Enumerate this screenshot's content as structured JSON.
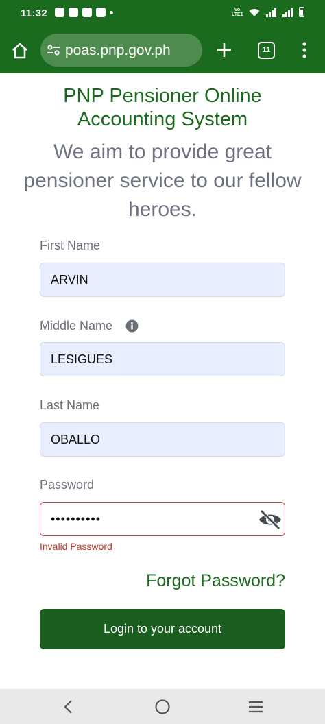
{
  "status_bar": {
    "time": "11:32",
    "volte": "Vo LTE1"
  },
  "browser": {
    "url": "pnpoas.pnp.gov.ph",
    "url_visible": "poas.pnp.gov.ph",
    "tab_count": "11"
  },
  "page": {
    "title": "PNP Pensioner Online Accounting System",
    "subtitle": "We aim to provide great pensioner service to our fellow heroes.",
    "brand_color": "#1b6b1e"
  },
  "form": {
    "first_name": {
      "label": "First Name",
      "value": "ARVIN"
    },
    "middle_name": {
      "label": "Middle Name",
      "value": "LESIGUES"
    },
    "last_name": {
      "label": "Last Name",
      "value": "OBALLO"
    },
    "password": {
      "label": "Password",
      "value": "••••••••••",
      "error": "Invalid Password",
      "error_color": "#c0392b"
    },
    "forgot_link": "Forgot Password?",
    "submit_label": "Login to your account"
  },
  "icons": {
    "home": "home-icon",
    "site_settings": "tune-icon",
    "new_tab": "plus-icon",
    "menu": "kebab-menu-icon",
    "info": "info-icon",
    "password_visibility": "eye-off-icon",
    "nav_back": "back-icon",
    "nav_home": "home-circle-icon",
    "nav_recents": "recents-icon"
  }
}
